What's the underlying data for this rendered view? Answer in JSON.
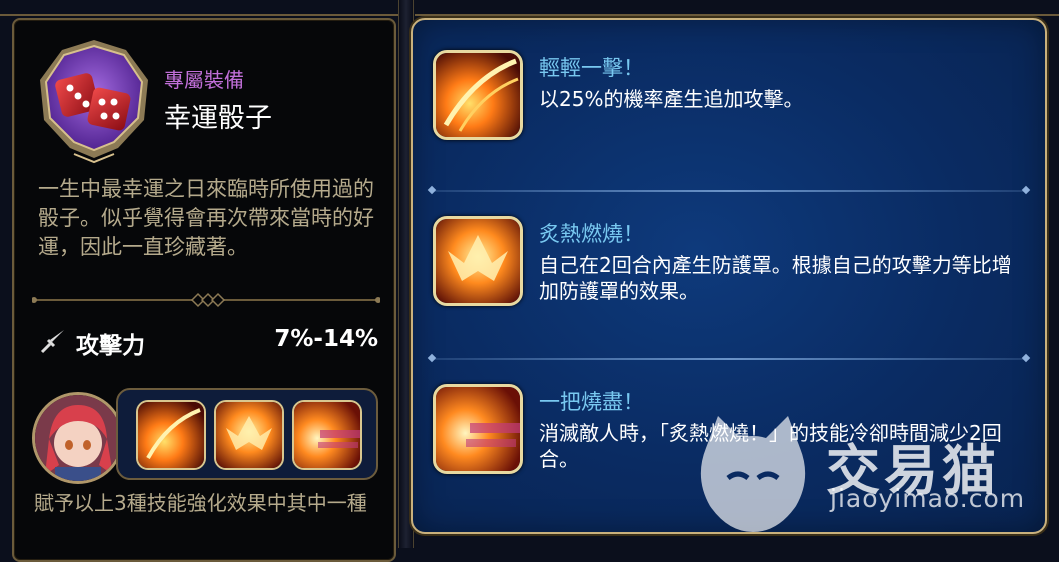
{
  "item": {
    "category_label": "專屬裝備",
    "name": "幸運骰子",
    "icon": "dice-icon",
    "description": "一生中最幸運之日來臨時所使用過的骰子。似乎覺得會再次帶來當時的好運，因此一直珍藏著。",
    "stat": {
      "icon": "sword-icon",
      "label": "攻擊力",
      "value": "7%-14%"
    },
    "footer": "賦予以上3種技能強化效果中其中一種"
  },
  "skills": [
    {
      "name": "輕輕一擊！",
      "description": "以25%的機率產生追加攻擊。",
      "icon": "flame-slash-icon"
    },
    {
      "name": "炙熱燃燒！",
      "description": "自己在2回合內產生防護罩。根據自己的攻擊力等比增加防護罩的效果。",
      "icon": "phoenix-flame-icon"
    },
    {
      "name": "一把燒盡！",
      "description": "消滅敵人時，「炙熱燃燒！」的技能冷卻時間減少2回合。",
      "icon": "fire-burst-icon"
    }
  ],
  "watermark": {
    "text": "交易猫",
    "url": "jiaoyimao.com"
  },
  "colors": {
    "accent_gold": "#c9b17d",
    "skill_name": "#78c8f0",
    "category": "#c06fd8",
    "panel_blue": "#0a2b62"
  }
}
